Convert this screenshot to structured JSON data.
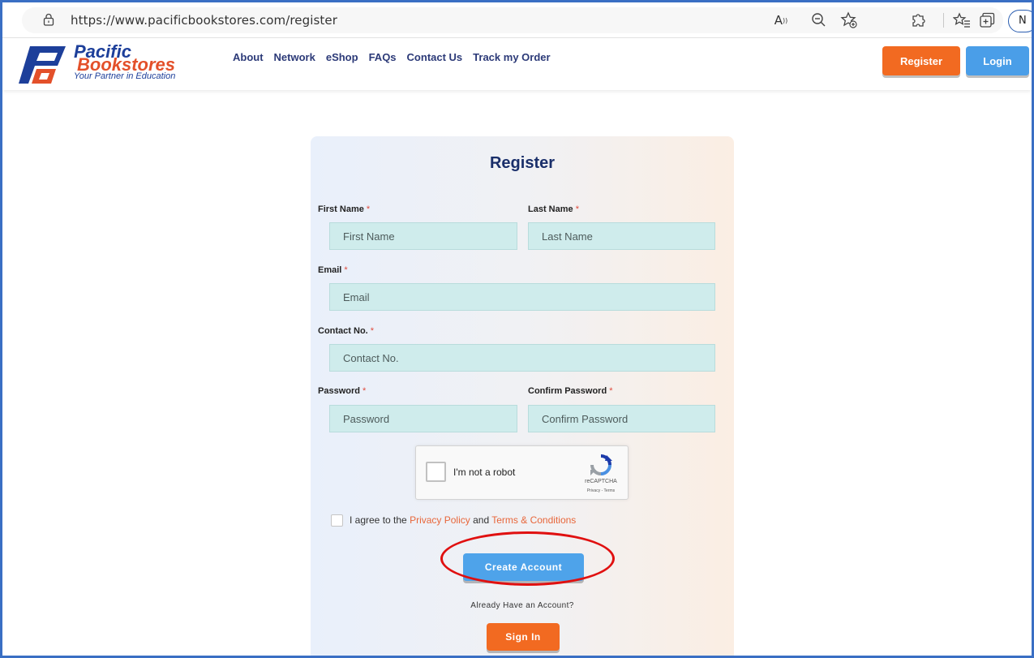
{
  "browser": {
    "url": "https://www.pacificbookstores.com/register",
    "profile_initial": "N",
    "icons": [
      "lock-icon",
      "read-aloud-icon",
      "zoom-out-icon",
      "favorite-add-icon",
      "extensions-icon",
      "favorites-icon",
      "collections-icon"
    ]
  },
  "header": {
    "logo_line1": "Pacific",
    "logo_line2": "Bookstores",
    "logo_tagline": "Your Partner in Education",
    "nav": [
      "About",
      "Network",
      "eShop",
      "FAQs",
      "Contact Us",
      "Track my Order"
    ],
    "register_label": "Register",
    "login_label": "Login",
    "colors": {
      "register": "#f26a21",
      "login": "#4a9ee8",
      "brand_blue": "#1d3f9a",
      "brand_orange": "#e3502a"
    }
  },
  "form": {
    "title": "Register",
    "required_mark": "*",
    "first_name": {
      "label": "First Name",
      "placeholder": "First Name"
    },
    "last_name": {
      "label": "Last Name",
      "placeholder": "Last Name"
    },
    "email": {
      "label": "Email",
      "placeholder": "Email"
    },
    "contact": {
      "label": "Contact No.",
      "placeholder": "Contact No."
    },
    "password": {
      "label": "Password",
      "placeholder": "Password"
    },
    "confirm_password": {
      "label": "Confirm Password",
      "placeholder": "Confirm Password"
    },
    "captcha": {
      "text": "I'm not a robot",
      "brand": "reCAPTCHA",
      "links": "Privacy - Terms"
    },
    "agree": {
      "prefix": "I agree to the",
      "privacy": "Privacy Policy",
      "and": "and",
      "terms": "Terms & Conditions"
    },
    "create_label": "Create Account",
    "already_text": "Already Have an Account?",
    "signin_label": "Sign In"
  }
}
